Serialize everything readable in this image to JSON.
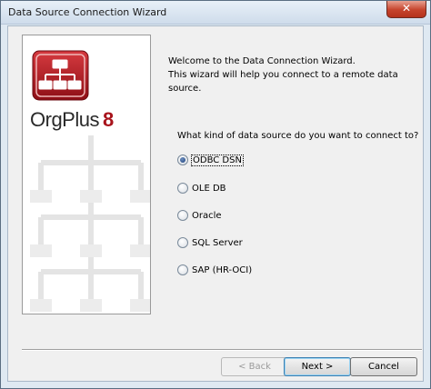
{
  "window": {
    "title": "Data Source Connection Wizard",
    "close_glyph": "✕"
  },
  "side_panel": {
    "brand_name": "OrgPlus",
    "brand_version": "8",
    "logo_icon": "org-chart-icon",
    "colors": {
      "logo_red": "#b3141c",
      "brand_red": "#a8141c"
    }
  },
  "intro": {
    "line1": "Welcome to the Data Connection Wizard.",
    "line2": "This wizard will help you connect to a remote data source."
  },
  "question": "What kind of data source do you want to connect to?",
  "options": [
    {
      "label": "ODBC DSN",
      "checked": true
    },
    {
      "label": "OLE DB",
      "checked": false
    },
    {
      "label": "Oracle",
      "checked": false
    },
    {
      "label": "SQL Server",
      "checked": false
    },
    {
      "label": "SAP (HR-OCI)",
      "checked": false
    }
  ],
  "buttons": {
    "back": "< Back",
    "next": "Next >",
    "cancel": "Cancel"
  }
}
